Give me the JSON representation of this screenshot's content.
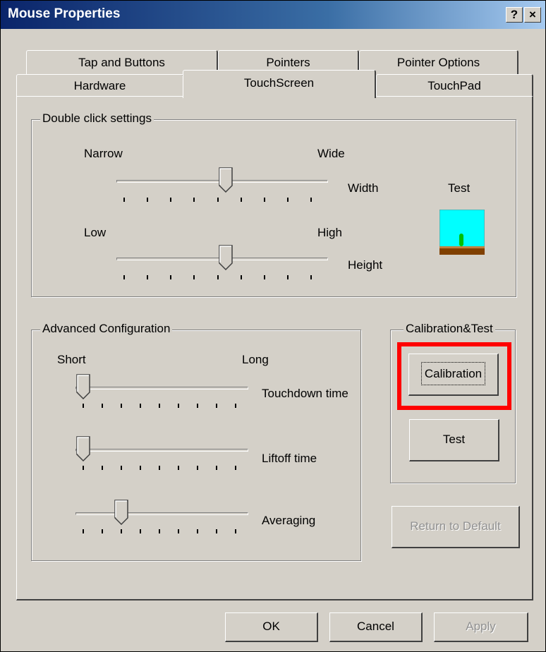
{
  "window": {
    "title": "Mouse Properties",
    "help_label": "?",
    "close_label": "×"
  },
  "tabs": {
    "row1": [
      "Tap and Buttons",
      "Pointers",
      "Pointer Options"
    ],
    "row2": [
      "Hardware",
      "TouchScreen",
      "TouchPad"
    ],
    "active": "TouchScreen"
  },
  "double_click": {
    "group_title": "Double click settings",
    "width": {
      "left": "Narrow",
      "right": "Wide",
      "label": "Width",
      "value_fraction": 0.53
    },
    "height": {
      "left": "Low",
      "right": "High",
      "label": "Height",
      "value_fraction": 0.53
    },
    "test_label": "Test"
  },
  "advanced": {
    "group_title": "Advanced Configuration",
    "left": "Short",
    "right": "Long",
    "touchdown": {
      "label": "Touchdown time",
      "value_fraction": 0.0
    },
    "liftoff": {
      "label": "Liftoff time",
      "value_fraction": 0.0
    },
    "averaging": {
      "label": "Averaging",
      "value_fraction": 0.25
    }
  },
  "calibration": {
    "group_title": "Calibration&Test",
    "calibration_label": "Calibration",
    "test_label": "Test",
    "highlight_color": "#ff0000"
  },
  "buttons": {
    "return_default": "Return to Default",
    "ok": "OK",
    "cancel": "Cancel",
    "apply": "Apply"
  }
}
